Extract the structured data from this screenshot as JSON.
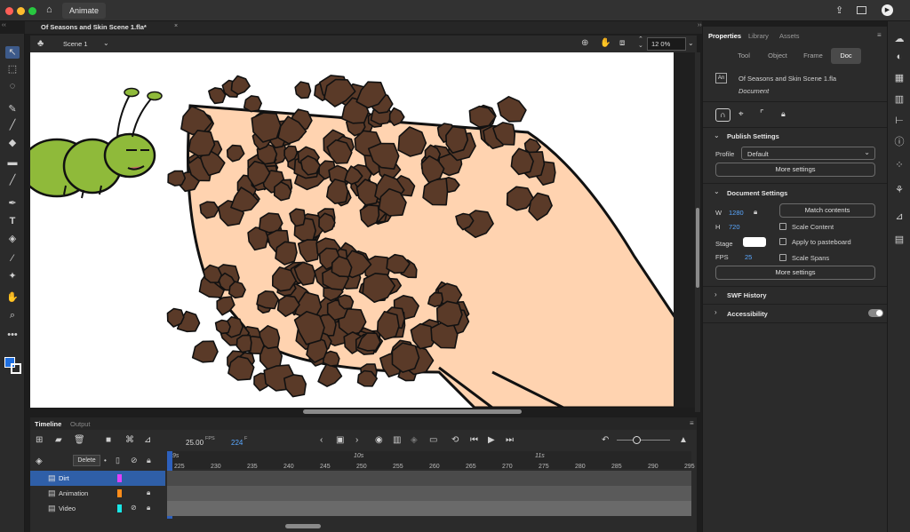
{
  "app": {
    "tab_label": "Animate",
    "document_tab": "Of Seasons and Skin Scene 1.fla*",
    "close_glyph": "×"
  },
  "scene": {
    "name": "Scene 1",
    "zoom": "12 0%"
  },
  "properties": {
    "tabs": [
      "Properties",
      "Library",
      "Assets"
    ],
    "segments": [
      "Tool",
      "Object",
      "Frame",
      "Doc"
    ],
    "active_segment": "Doc",
    "doc_badge": "An",
    "doc_name": "Of Seasons and Skin Scene 1.fla",
    "doc_type": "Document",
    "publish": {
      "title": "Publish Settings",
      "profile_label": "Profile",
      "profile_value": "Default",
      "more_button": "More settings"
    },
    "document_settings": {
      "title": "Document Settings",
      "w_label": "W",
      "w_value": "1280",
      "h_label": "H",
      "h_value": "720",
      "match_button": "Match contents",
      "scale_content": "Scale Content",
      "stage_label": "Stage",
      "stage_color": "#ffffff",
      "apply_pasteboard": "Apply to pasteboard",
      "fps_label": "FPS",
      "fps_value": "25",
      "scale_spans": "Scale Spans",
      "more_button": "More settings"
    },
    "swf_history": "SWF History",
    "accessibility": "Accessibility"
  },
  "timeline": {
    "tabs": [
      "Timeline",
      "Output"
    ],
    "fps_value": "25.00",
    "fps_unit": "FPS",
    "frame_value": "224",
    "frame_unit": "F",
    "tooltip": "Delete",
    "ruler_ticks": [
      "225",
      "230",
      "235",
      "240",
      "245",
      "250",
      "255",
      "260",
      "265",
      "270",
      "275",
      "280",
      "285",
      "290",
      "295"
    ],
    "ruler_seconds": [
      "9s",
      "10s",
      "11s"
    ],
    "layers": [
      {
        "name": "Dirt",
        "color": "#e040fb"
      },
      {
        "name": "Animation",
        "color": "#ff8c1a"
      },
      {
        "name": "Video",
        "color": "#19e6e6"
      }
    ]
  },
  "colors": {
    "accent": "#2f6bd8",
    "dirt_brown": "#5a3a28",
    "skin": "#ffd3b0",
    "caterpillar_green": "#8fba3a"
  }
}
